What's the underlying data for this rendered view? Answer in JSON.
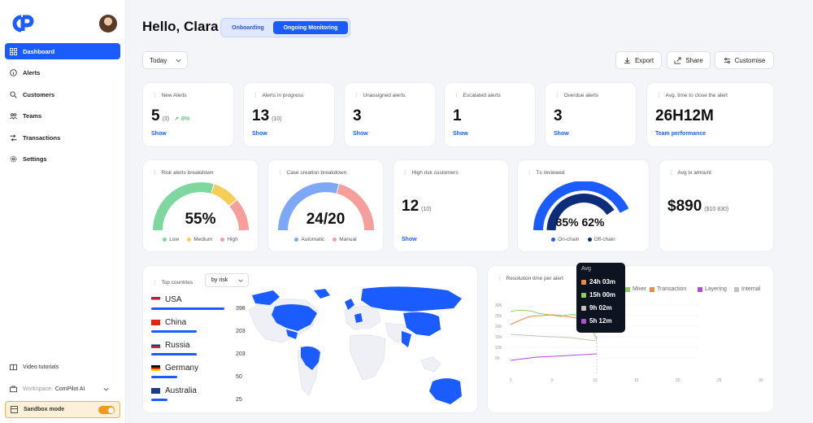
{
  "colors": {
    "accent": "#1a5cff",
    "green": "#1faa4a",
    "amber": "#f3b23c"
  },
  "sidebar": {
    "items": [
      {
        "label": "Dashboard",
        "icon": "grid-icon",
        "active": true
      },
      {
        "label": "Alerts",
        "icon": "info-icon"
      },
      {
        "label": "Customers",
        "icon": "search-user-icon"
      },
      {
        "label": "Teams",
        "icon": "team-icon"
      },
      {
        "label": "Transactions",
        "icon": "shuffle-icon"
      },
      {
        "label": "Settings",
        "icon": "gear-icon"
      }
    ],
    "video": "Video tutorials",
    "workspace_prefix": "Workspace:",
    "workspace": "ComPilot AI",
    "sandbox": "Sandbox mode"
  },
  "header": {
    "greeting": "Hello, Clara",
    "tabs": [
      "Onboarding",
      "Ongoing Monitoring"
    ],
    "active_tab": "Ongoing Monitoring",
    "range": "Today",
    "actions": [
      "Export",
      "Share",
      "Customise"
    ]
  },
  "kpis": [
    {
      "title": "New Alerts",
      "value": "5",
      "sub": "(3)",
      "trend": "8%",
      "link": "Show"
    },
    {
      "title": "Alerts in progress",
      "value": "13",
      "sub": "(10)",
      "link": "Show"
    },
    {
      "title": "Unassigned alerts",
      "value": "3",
      "link": "Show"
    },
    {
      "title": "Escalated alerts",
      "value": "1",
      "link": "Show"
    },
    {
      "title": "Overdue alerts",
      "value": "3",
      "link": "Show"
    },
    {
      "title": "Avg. time to close the alert",
      "value": "26H12M",
      "link": "Team performance"
    }
  ],
  "risk": {
    "title": "Risk alerts breakdown",
    "value": "55%",
    "legend": [
      "Low",
      "Medium",
      "High"
    ]
  },
  "case": {
    "title": "Case creation breakdown",
    "value": "24/20",
    "legend": [
      "Automatic",
      "Manual"
    ]
  },
  "highrisk": {
    "title": "High risk customers",
    "value": "12",
    "sub": "(10)",
    "link": "Show"
  },
  "tx": {
    "title": "Tx reviewed",
    "value": "85% 62%",
    "legend": [
      "On-chain",
      "Off-chain"
    ]
  },
  "avgtx": {
    "title": "Avg tx amount",
    "value": "$890",
    "sub": "($10 830)"
  },
  "countries": {
    "title": "Top countries",
    "filter": "by risk",
    "rows": [
      {
        "name": "USA",
        "value": "398",
        "share": 1.0
      },
      {
        "name": "China",
        "value": "203",
        "share": 0.62
      },
      {
        "name": "Russia",
        "value": "203",
        "share": 0.62
      },
      {
        "name": "Germany",
        "value": "50",
        "share": 0.35
      },
      {
        "name": "Australia",
        "value": "25",
        "share": 0.22
      }
    ]
  },
  "resolution": {
    "title": "Resolution time per alert",
    "legend": [
      "Mixer",
      "Transaction",
      "Layering",
      "Internal"
    ],
    "tooltip": {
      "header": "Avg",
      "rows": [
        "24h 03m",
        "15h 00m",
        "9h 02m",
        "5h 12m"
      ]
    },
    "yticks": [
      "30h",
      "25h",
      "20h",
      "15h",
      "10h",
      "5h"
    ],
    "xticks": [
      "1",
      "5",
      "10",
      "15",
      "20",
      "25",
      "30"
    ]
  }
}
